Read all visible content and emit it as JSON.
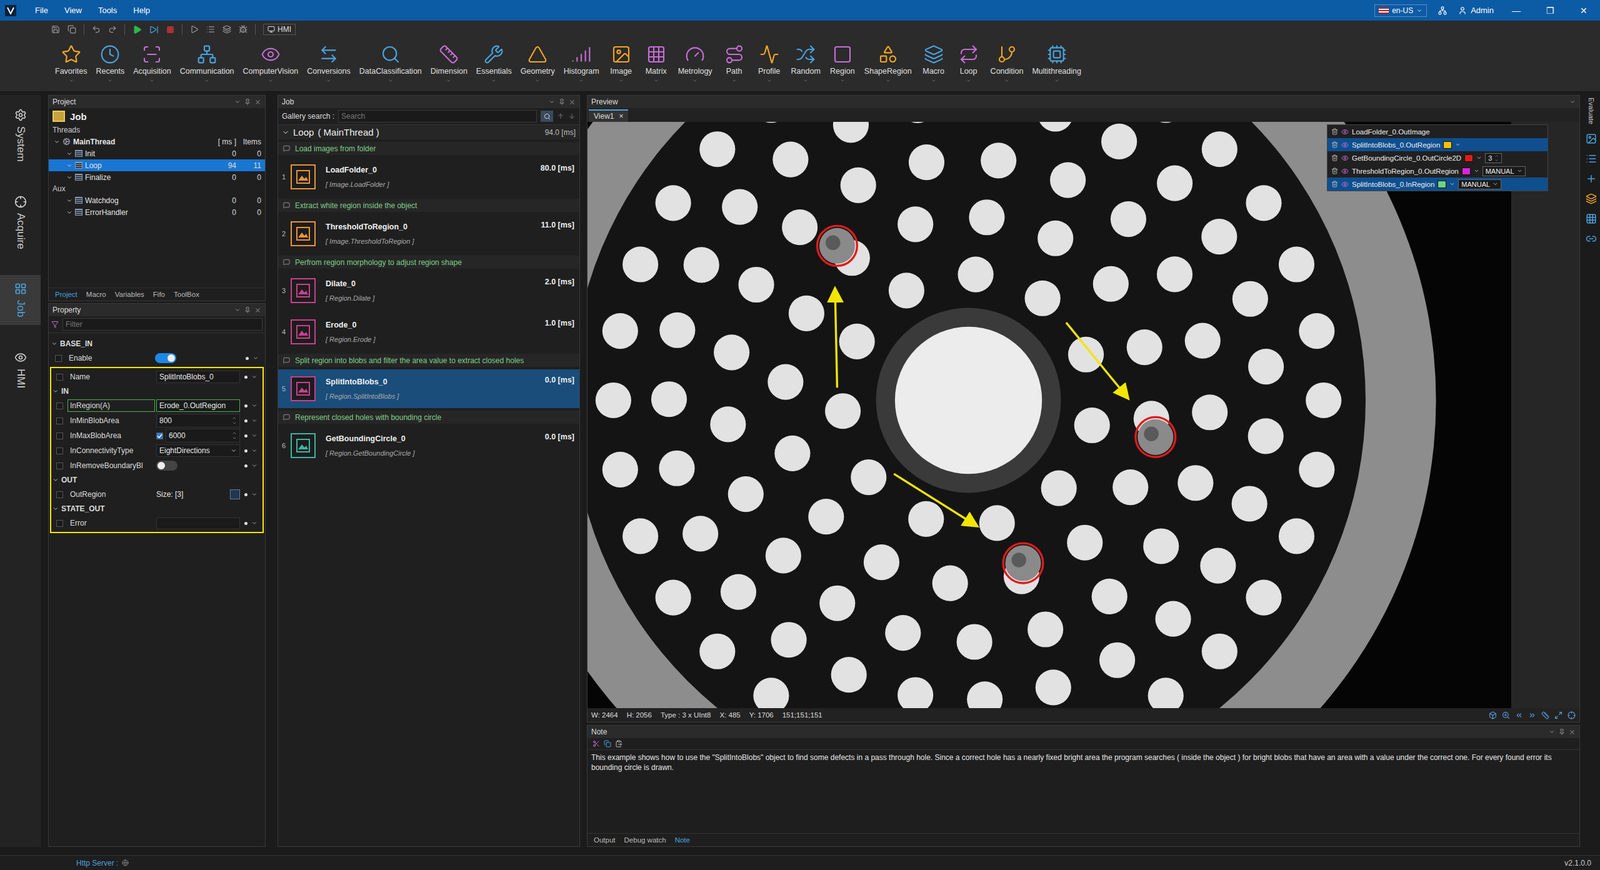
{
  "titleBar": {
    "menu": [
      "File",
      "View",
      "Tools",
      "Help"
    ],
    "language": "en-US",
    "user": "Admin",
    "controls": [
      "—",
      "❐",
      "✕"
    ]
  },
  "quickBar": {
    "hmi": "HMI"
  },
  "toolbar": [
    "Favorites",
    "Recents",
    "Acquisition",
    "Communication",
    "ComputerVision",
    "Conversions",
    "DataClassification",
    "Dimension",
    "Essentials",
    "Geometry",
    "Histogram",
    "Image",
    "Matrix",
    "Metrology",
    "Path",
    "Profile",
    "Random",
    "Region",
    "ShapeRegion",
    "Macro",
    "Loop",
    "Condition",
    "Multithreading"
  ],
  "sideTabs": [
    {
      "label": "System",
      "selected": false
    },
    {
      "label": "Acquire",
      "selected": false
    },
    {
      "label": "Job",
      "selected": true
    },
    {
      "label": "HMI",
      "selected": false
    }
  ],
  "project": {
    "title": "Project",
    "root": "Job",
    "groups": [
      {
        "label": "Threads",
        "rows": [
          {
            "name": "MainThread",
            "ms": "[ ms ]",
            "items": "Items",
            "depth": 0,
            "expanded": true,
            "selected": false,
            "kind": "thread"
          },
          {
            "name": "Init",
            "ms": "0",
            "items": "0",
            "depth": 1,
            "expanded": true,
            "selected": false,
            "kind": "task"
          },
          {
            "name": "Loop",
            "ms": "94",
            "items": "11",
            "depth": 1,
            "expanded": true,
            "selected": true,
            "kind": "task"
          },
          {
            "name": "Finalize",
            "ms": "0",
            "items": "0",
            "depth": 1,
            "expanded": true,
            "selected": false,
            "kind": "task"
          }
        ]
      },
      {
        "label": "Aux",
        "rows": [
          {
            "name": "Watchdog",
            "ms": "0",
            "items": "0",
            "depth": 1,
            "expanded": true,
            "selected": false,
            "kind": "task"
          },
          {
            "name": "ErrorHandler",
            "ms": "0",
            "items": "0",
            "depth": 1,
            "expanded": true,
            "selected": false,
            "kind": "task"
          }
        ]
      }
    ],
    "tabs": [
      {
        "label": "Project",
        "selected": true
      },
      {
        "label": "Macro",
        "selected": false
      },
      {
        "label": "Variables",
        "selected": false
      },
      {
        "label": "Fifo",
        "selected": false
      },
      {
        "label": "ToolBox",
        "selected": false
      }
    ]
  },
  "property": {
    "title": "Property",
    "filterPlaceholder": "Filter",
    "sections": [
      {
        "name": "BASE_IN",
        "highlighted": false,
        "rows": [
          {
            "label": "Enable",
            "kind": "toggle",
            "on": true,
            "checked": false
          }
        ]
      },
      {
        "name": "",
        "highlighted": true,
        "rows": [
          {
            "label": "Name",
            "kind": "text",
            "value": "SplitIntoBlobs_0",
            "checked": false
          }
        ]
      },
      {
        "name": "IN",
        "highlighted": true,
        "rows": [
          {
            "label": "InRegion(A)",
            "kind": "link",
            "value": "Erode_0.OutRegion",
            "checked": false,
            "focused": true
          },
          {
            "label": "InMinBlobArea",
            "kind": "number",
            "value": "800",
            "checked": false
          },
          {
            "label": "InMaxBlobArea",
            "kind": "number",
            "value": "6000",
            "checked": false,
            "limitOn": true
          },
          {
            "label": "InConnectivityType",
            "kind": "select",
            "value": "EightDirections",
            "checked": false
          },
          {
            "label": "InRemoveBoundaryBl",
            "kind": "toggle",
            "on": false,
            "checked": false
          }
        ]
      },
      {
        "name": "OUT",
        "highlighted": true,
        "rows": [
          {
            "label": "OutRegion",
            "kind": "region",
            "value": "Size: [3]",
            "checked": false
          }
        ]
      },
      {
        "name": "STATE_OUT",
        "highlighted": true,
        "rows": [
          {
            "label": "Error",
            "kind": "text",
            "value": "",
            "checked": false
          }
        ]
      }
    ]
  },
  "job": {
    "title": "Job",
    "searchLabel": "Gallery search :",
    "searchPlaceholder": "Search",
    "header": "Loop",
    "headerThread": "( MainThread )",
    "headerTime": "94.0 [ms]",
    "items": [
      {
        "kind": "comment",
        "text": "Load images from folder"
      },
      {
        "kind": "tool",
        "number": "1",
        "name": "LoadFolder_0",
        "type": "[ Image.LoadFolder ]",
        "time": "80.0 [ms]",
        "color": "#e8953a",
        "selected": false
      },
      {
        "kind": "comment",
        "text": "Extract white region inside the object"
      },
      {
        "kind": "tool",
        "number": "2",
        "name": "ThresholdToRegion_0",
        "type": "[ Image.ThresholdToRegion ]",
        "time": "11.0 [ms]",
        "color": "#e8953a",
        "selected": false
      },
      {
        "kind": "comment",
        "text": "Perfrom region morphology to adjust region shape"
      },
      {
        "kind": "tool",
        "number": "3",
        "name": "Dilate_0",
        "type": "[ Region.Dilate ]",
        "time": "2.0 [ms]",
        "color": "#c8408f",
        "selected": false
      },
      {
        "kind": "tool",
        "number": "4",
        "name": "Erode_0",
        "type": "[ Region.Erode ]",
        "time": "1.0 [ms]",
        "color": "#c8408f",
        "selected": false
      },
      {
        "kind": "comment",
        "text": "Split region into blobs and filter the area value to extract closed holes"
      },
      {
        "kind": "tool",
        "number": "5",
        "name": "SplitIntoBlobs_0",
        "type": "[ Region.SplitIntoBlobs ]",
        "time": "0.0 [ms]",
        "color": "#c8408f",
        "selected": true
      },
      {
        "kind": "comment",
        "text": "Represent closed holes with bounding circle"
      },
      {
        "kind": "tool",
        "number": "6",
        "name": "GetBoundingCircle_0",
        "type": "[ Region.GetBoundingCircle ]",
        "time": "0.0 [ms]",
        "color": "#3fb4a5",
        "selected": false
      }
    ]
  },
  "preview": {
    "title": "Preview",
    "tabs": [
      {
        "label": "View1",
        "selected": true,
        "close": "×"
      }
    ],
    "layers": [
      {
        "label": "LoadFolder_0.OutImage",
        "selected": false,
        "kind": "plain"
      },
      {
        "label": "SplitIntoBlobs_0.OutRegion",
        "selected": true,
        "kind": "swatch",
        "color": "#f2c200"
      },
      {
        "label": "GetBoundingCircle_0.OutCircle2D",
        "selected": false,
        "kind": "number",
        "color": "#e01b1b",
        "value": "3"
      },
      {
        "label": "ThresholdToRegion_0.OutRegion",
        "selected": false,
        "kind": "select",
        "color": "#d926d9",
        "value": "MANUAL"
      },
      {
        "label": "SplitIntoBlobs_0.InRegion",
        "selected": true,
        "kind": "select",
        "color": "#6fd47f",
        "value": "MANUAL"
      }
    ],
    "status": [
      "W: 2464",
      "H: 2056",
      "Type : 3  x  UInt8",
      "X: 485",
      "Y: 1706",
      "151;151;151"
    ]
  },
  "note": {
    "title": "Note",
    "text": "This example shows how to use the \"SplitIntoBlobs\" object to find some defects in a pass through hole. Since a correct hole has a nearly fixed bright area the  program searches ( inside the object ) for bright blobs that have an area with a value under the correct one. For every found error its bounding circle is drawn.",
    "tabs": [
      {
        "label": "Output",
        "selected": false
      },
      {
        "label": "Debug watch",
        "selected": false
      },
      {
        "label": "Note",
        "selected": true
      }
    ]
  },
  "rightStrip": {
    "label": "Evaluate"
  },
  "statusBar": {
    "server": "Http Server :",
    "version": "v2.1.0.0"
  }
}
